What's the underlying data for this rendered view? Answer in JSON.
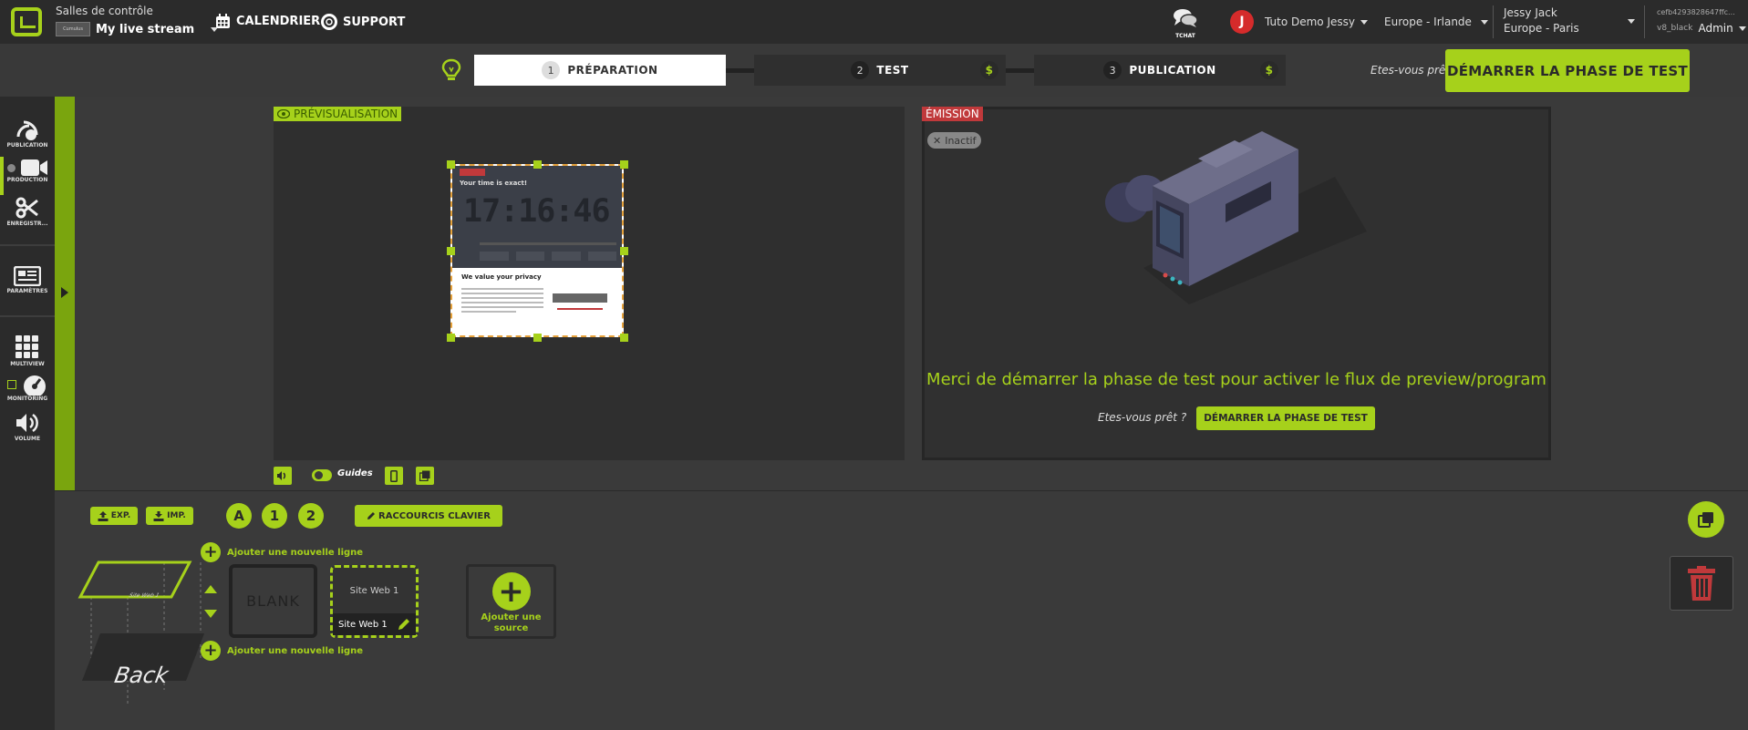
{
  "header": {
    "room_title": "Salles de contrôle",
    "stream_thumb": "Cumulus",
    "stream_name": "My live stream",
    "nav": [
      {
        "label": "CALENDRIER",
        "icon": "calendar-icon"
      },
      {
        "label": "SUPPORT",
        "icon": "support-icon"
      }
    ],
    "chat_label": "TCHAT",
    "avatar_letter": "J",
    "org_name": "Tuto Demo Jessy",
    "region": "Europe - Irlande",
    "user_name": "Jessy Jack",
    "user_timezone": "Europe - Paris",
    "account_id": "cefb4293828647ffc...",
    "version": "v8_black",
    "role": "Admin"
  },
  "steps": {
    "items": [
      {
        "num": "1",
        "label": "PRÉPARATION"
      },
      {
        "num": "2",
        "label": "TEST",
        "badge": "$"
      },
      {
        "num": "3",
        "label": "PUBLICATION",
        "badge": "$"
      }
    ],
    "ready_text": "Etes-vous prêt",
    "start_button": "DÉMARRER LA PHASE DE TEST"
  },
  "sidebar": {
    "items": [
      {
        "label": "PUBLICATION",
        "icon": "satellite-icon"
      },
      {
        "label": "PRODUCTION",
        "icon": "camera-icon"
      },
      {
        "label": "ENREGISTR...",
        "icon": "scissors-icon"
      },
      {
        "label": "PARAMÈTRES",
        "icon": "newspaper-icon"
      },
      {
        "label": "MULTIVIEW",
        "icon": "grid-icon"
      },
      {
        "label": "MONITORING",
        "icon": "gauge-icon"
      },
      {
        "label": "VOLUME",
        "icon": "volume-icon"
      }
    ]
  },
  "preview": {
    "label": "PRÉVISUALISATION",
    "site_heading": "Your time is exact!",
    "clock": "17:16:46",
    "privacy_title": "We value your privacy",
    "guides_label": "Guides"
  },
  "emission": {
    "label": "ÉMISSION",
    "status": "Inactif",
    "message": "Merci de démarrer la phase de test pour activer le flux de preview/program",
    "ready_text": "Etes-vous prêt ?",
    "start_button": "DÉMARRER LA PHASE DE TEST"
  },
  "bottom": {
    "export": "EXP.",
    "import": "IMP.",
    "layers": [
      "A",
      "1",
      "2"
    ],
    "shortcuts": "RACCOURCIS CLAVIER",
    "add_line": "Ajouter une nouvelle ligne",
    "layer_front_label": "Site Web 1",
    "layer_back_label": "Back",
    "blank": "BLANK",
    "source_title": "Site Web 1",
    "source_name": "Site Web 1",
    "add_source": "Ajouter une source"
  },
  "colors": {
    "accent": "#a6d11b",
    "emission_red": "#c0393b"
  }
}
